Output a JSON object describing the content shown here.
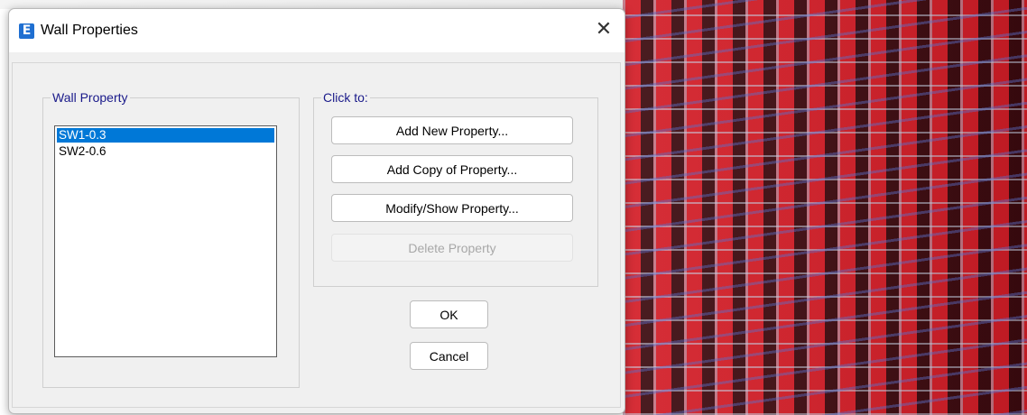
{
  "dialog": {
    "title": "Wall Properties",
    "app_icon_letter": "E",
    "close_glyph": "✕"
  },
  "wall_property": {
    "legend": "Wall Property",
    "items": [
      "SW1-0.3",
      "SW2-0.6"
    ],
    "selected_index": 0
  },
  "click_to": {
    "legend": "Click to:",
    "add_new": "Add New Property...",
    "add_copy": "Add Copy of Property...",
    "modify_show": "Modify/Show Property...",
    "delete": "Delete Property"
  },
  "buttons": {
    "ok": "OK",
    "cancel": "Cancel"
  },
  "colors": {
    "selection": "#0078d7",
    "legend_text": "#1a1a8a",
    "app_icon": "#1f6fd1"
  }
}
